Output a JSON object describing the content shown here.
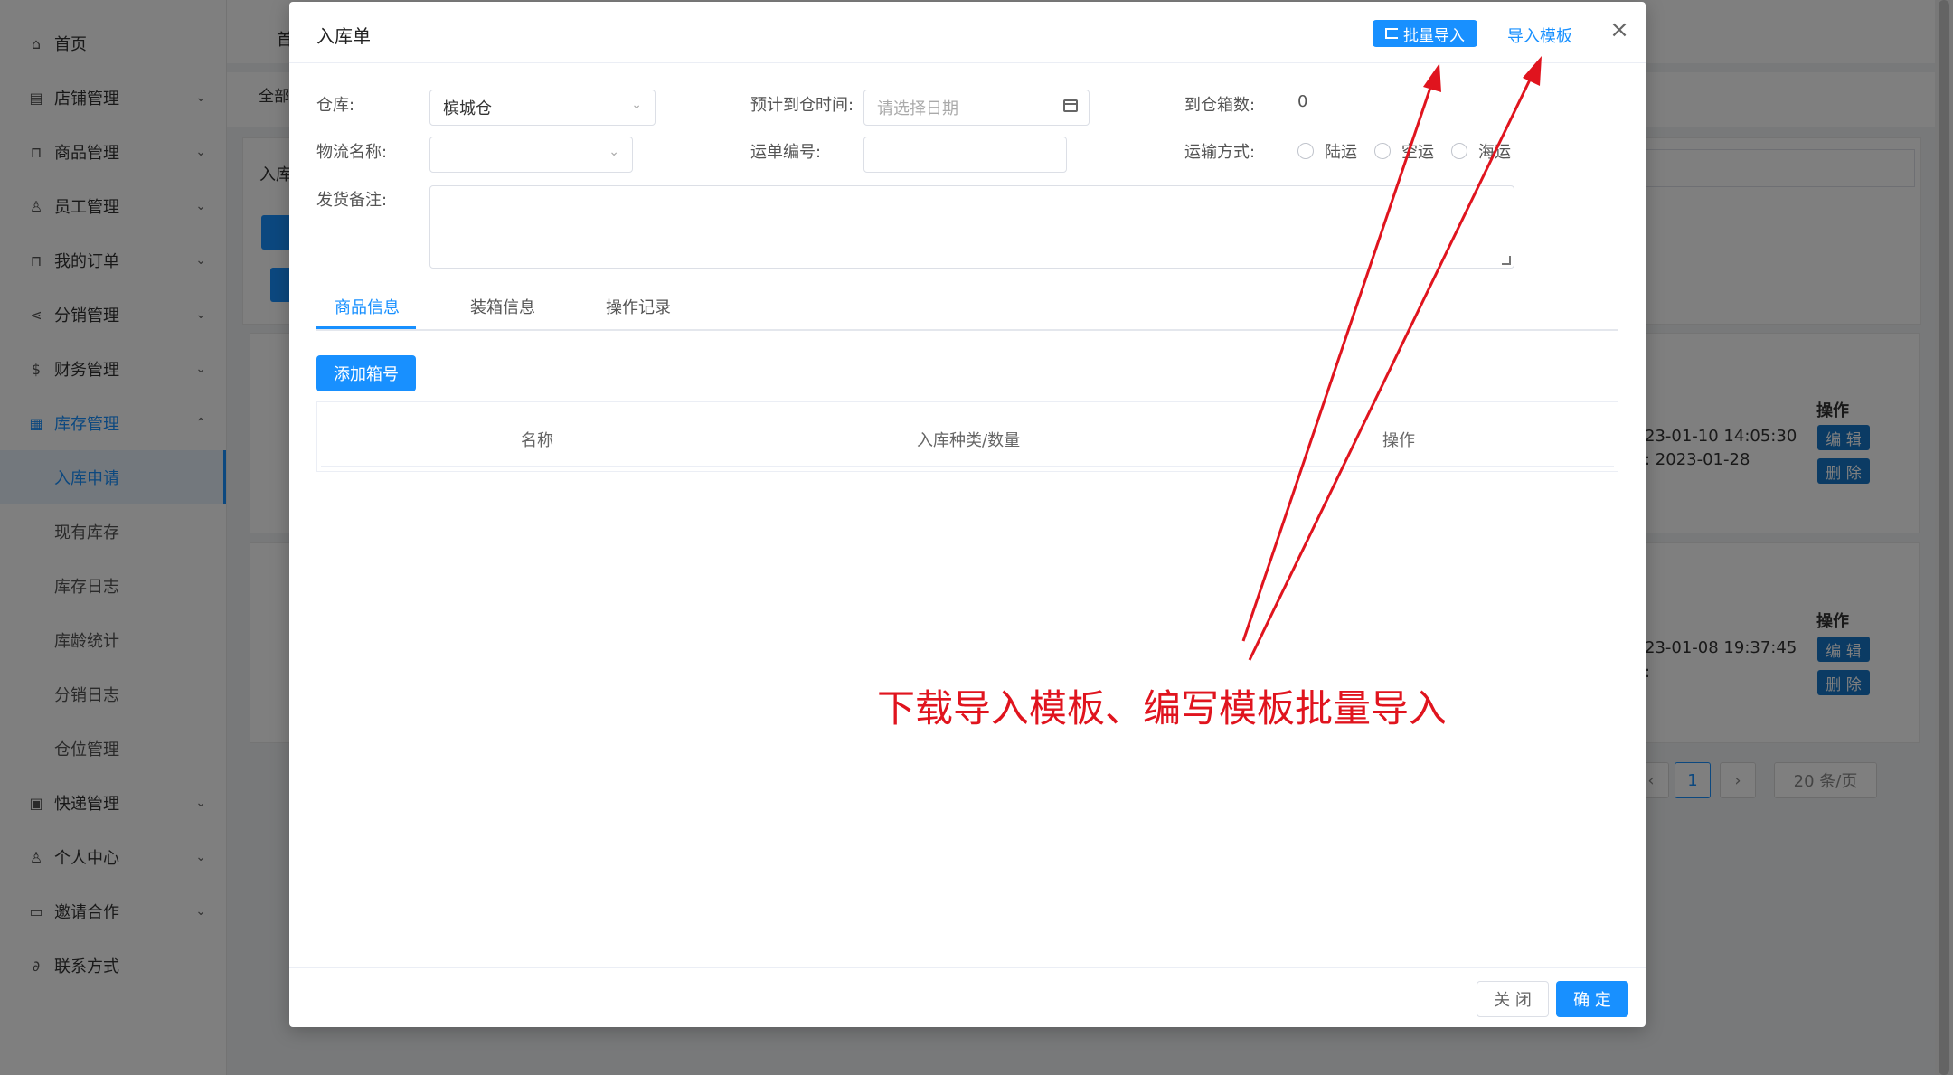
{
  "sidebar": {
    "items": [
      {
        "label": "首页",
        "icon": "home-icon"
      },
      {
        "label": "店铺管理",
        "icon": "store-icon"
      },
      {
        "label": "商品管理",
        "icon": "bag-icon"
      },
      {
        "label": "员工管理",
        "icon": "user-icon"
      },
      {
        "label": "我的订单",
        "icon": "order-icon"
      },
      {
        "label": "分销管理",
        "icon": "share-icon"
      },
      {
        "label": "财务管理",
        "icon": "dollar-icon"
      },
      {
        "label": "库存管理",
        "icon": "grid-icon"
      }
    ],
    "sub_items": [
      {
        "label": "入库申请"
      },
      {
        "label": "现有库存"
      },
      {
        "label": "库存日志"
      },
      {
        "label": "库龄统计"
      },
      {
        "label": "分销日志"
      },
      {
        "label": "仓位管理"
      }
    ],
    "items_bottom": [
      {
        "label": "快递管理",
        "icon": "box-icon"
      },
      {
        "label": "个人中心",
        "icon": "person-icon"
      },
      {
        "label": "邀请合作",
        "icon": "monitor-icon"
      },
      {
        "label": "联系方式",
        "icon": "link-icon"
      }
    ]
  },
  "background": {
    "breadcrumb": "首",
    "tag_label": "全部",
    "row_label": "入库",
    "rows": [
      {
        "time1": "23-01-10 14:05:30",
        "time2": ":  2023-01-28"
      },
      {
        "time1": "23-01-08 19:37:45",
        "time2": ":"
      }
    ],
    "op_head": "操作",
    "edit_label": "编 辑",
    "delete_label": "删 除",
    "pager": {
      "current_page": "1",
      "page_size": "20 条/页",
      "prev": "‹",
      "next": "›"
    }
  },
  "dialog": {
    "title": "入库单",
    "import_button": "批量导入",
    "template_link": "导入模板",
    "close_glyph": "×",
    "form": {
      "warehouse_label": "仓库:",
      "warehouse_value": "槟城仓",
      "eta_label": "预计到仓时间:",
      "eta_placeholder": "请选择日期",
      "box_count_label": "到仓箱数:",
      "box_count_value": "0",
      "logistics_label": "物流名称:",
      "logistics_value": "",
      "waybill_label": "运单编号:",
      "waybill_value": "",
      "transport_label": "运输方式:",
      "transport_options": [
        "陆运",
        "空运",
        "海运"
      ],
      "remark_label": "发货备注:",
      "remark_value": ""
    },
    "tabs": [
      "商品信息",
      "装箱信息",
      "操作记录"
    ],
    "active_tab": "商品信息",
    "add_button": "添加箱号",
    "table_headers": [
      "名称",
      "入库种类/数量",
      "操作"
    ],
    "footer": {
      "cancel": "关 闭",
      "confirm": "确 定"
    }
  },
  "annotation": {
    "text": "下载导入模板、编写模板批量导入",
    "color": "#e0141e"
  },
  "colors": {
    "primary": "#1890ff",
    "annotation": "#e0141e"
  }
}
